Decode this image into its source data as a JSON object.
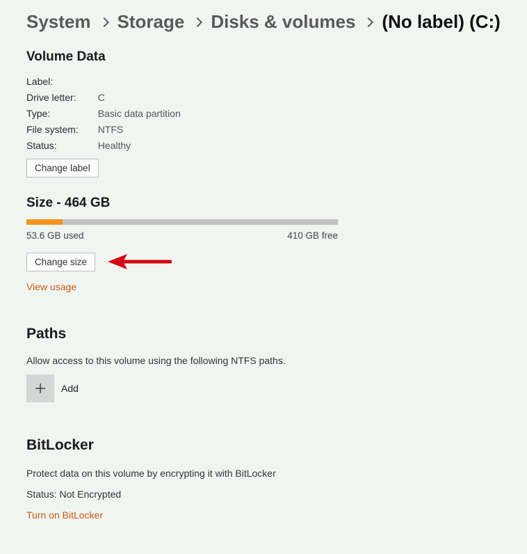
{
  "breadcrumb": {
    "system": "System",
    "storage": "Storage",
    "disks": "Disks & volumes",
    "current": "(No label) (C:)"
  },
  "volume_data": {
    "heading": "Volume Data",
    "rows": {
      "label_k": "Label:",
      "label_v": "",
      "drive_k": "Drive letter:",
      "drive_v": "C",
      "type_k": "Type:",
      "type_v": "Basic data partition",
      "fs_k": "File system:",
      "fs_v": "NTFS",
      "status_k": "Status:",
      "status_v": "Healthy"
    },
    "change_label_btn": "Change label"
  },
  "size": {
    "heading": "Size - 464 GB",
    "used_label": "53.6 GB used",
    "free_label": "410 GB free",
    "used_percent": 11.55,
    "change_size_btn": "Change size",
    "view_usage": "View usage"
  },
  "paths": {
    "heading": "Paths",
    "desc": "Allow access to this volume using the following NTFS paths.",
    "add_label": "Add"
  },
  "bitlocker": {
    "heading": "BitLocker",
    "desc": "Protect data on this volume by encrypting it with BitLocker",
    "status": "Status: Not Encrypted",
    "turn_on": "Turn on BitLocker"
  }
}
